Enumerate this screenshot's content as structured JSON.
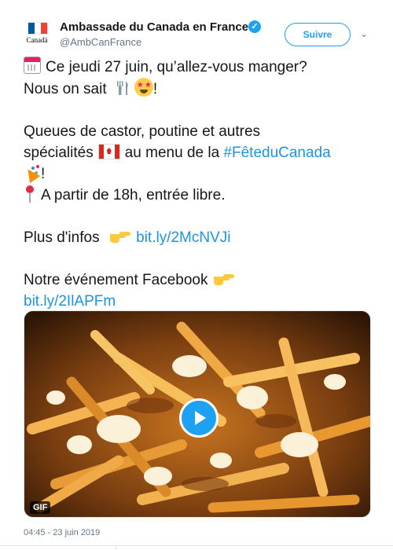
{
  "account": {
    "name": "Ambassade du Canada en France",
    "handle": "@AmbCanFrance",
    "avatar_wordmark": "Canadä",
    "verified_icon": "verified-badge-icon",
    "follow_label": "Suivre"
  },
  "tweet": {
    "line1_text": "Ce jeudi 27 juin, qu’allez-vous manger?",
    "line2_text": "Nous on sait",
    "line2_end": "!",
    "line3_text": "Queues de castor, poutine et autres",
    "line4_text": "spécialités",
    "line4_mid": "au menu de la",
    "hashtag": "#FêteduCanada",
    "line5_end": "!",
    "line6_text": "A partir de 18h, entrée libre.",
    "info_text": "Plus d'infos",
    "info_link": "bit.ly/2McNVJi",
    "fb_text": "Notre événement Facebook",
    "fb_link": "bit.ly/2IlAPFm"
  },
  "media": {
    "gif_label": "GIF",
    "play_icon": "play-icon"
  },
  "timestamp": "04:45 - 23 juin 2019",
  "colors": {
    "accent": "#1da1f2",
    "link": "#1b95e0",
    "text": "#14171a",
    "muted": "#657786"
  }
}
